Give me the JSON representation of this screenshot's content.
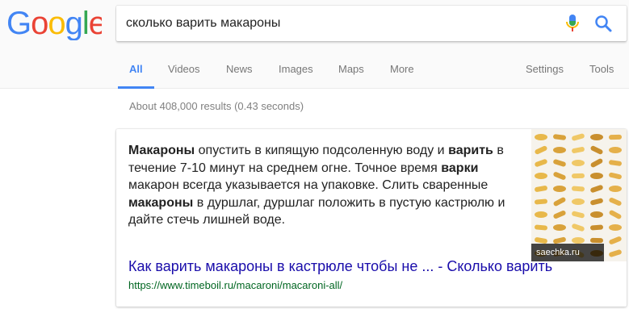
{
  "logo": {
    "text": "Google"
  },
  "search": {
    "query": "сколько варить макароны",
    "mic_icon": "microphone-icon",
    "search_icon": "magnifier-icon"
  },
  "tabs": [
    {
      "label": "All",
      "active": true
    },
    {
      "label": "Videos"
    },
    {
      "label": "News"
    },
    {
      "label": "Images"
    },
    {
      "label": "Maps"
    },
    {
      "label": "More"
    }
  ],
  "tools": {
    "settings": "Settings",
    "tools": "Tools"
  },
  "stats": "About 408,000 results (0.43 seconds)",
  "snippet": {
    "parts": [
      {
        "text": "Макароны",
        "bold": true
      },
      {
        "text": " опустить в кипящую подсоленную воду и ",
        "bold": false
      },
      {
        "text": "варить",
        "bold": true
      },
      {
        "text": " в течение 7-10 минут на среднем огне. Точное время ",
        "bold": false
      },
      {
        "text": "варки",
        "bold": true
      },
      {
        "text": " макарон всегда указывается на упаковке. Слить сваренные ",
        "bold": false
      },
      {
        "text": "макароны",
        "bold": true
      },
      {
        "text": " в дуршлаг, дуршлаг положить в пустую кастрюлю и дайте стечь лишней воде.",
        "bold": false
      }
    ],
    "image_caption": "saechka.ru",
    "result_title": "Как варить макароны в кастрюле чтобы не ... - Сколько варить",
    "result_url": "https://www.timeboil.ru/macaroni/macaroni-all/"
  },
  "colors": {
    "google_blue": "#4285F4",
    "google_red": "#EA4335",
    "google_yellow": "#FBBC05",
    "google_green": "#34A853",
    "link": "#1a0dab",
    "url": "#006621"
  }
}
